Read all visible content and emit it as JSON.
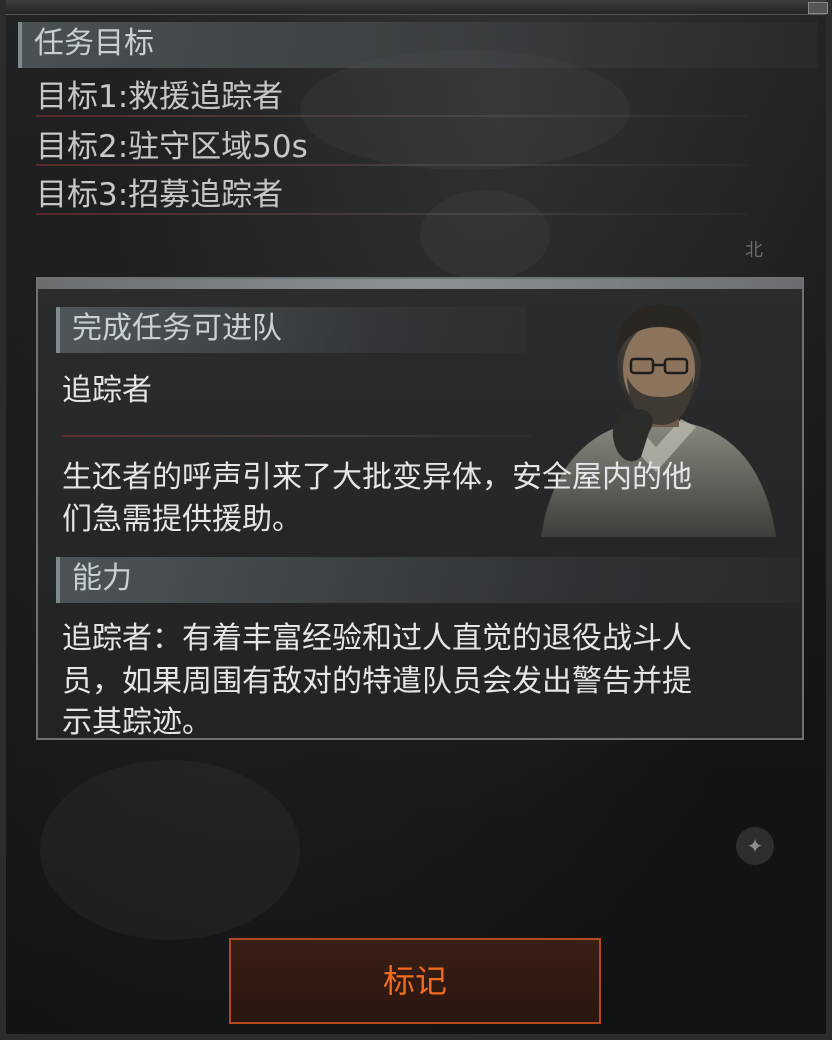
{
  "objectives": {
    "header": "任务目标",
    "items": [
      "目标1:救援追踪者",
      "目标2:驻守区域50s",
      "目标3:招募追踪者"
    ]
  },
  "recruit_panel": {
    "header": "完成任务可进队",
    "character_name": "追踪者",
    "description_line1": "生还者的呼声引来了大批变异体，安全屋内的他",
    "description_line2": "们急需提供援助。",
    "ability_header": "能力",
    "ability_line1": "追踪者：有着丰富经验和过人直觉的退役战斗人",
    "ability_line2": "员，如果周围有敌对的特遣队员会发出警告并提",
    "ability_line3": "示其踪迹。"
  },
  "map": {
    "north_label": "北"
  },
  "actions": {
    "mark_label": "标记"
  },
  "colors": {
    "accent_orange": "#f06a1f",
    "button_border": "#b4481e",
    "text_light": "#e3e6e7",
    "header_text": "#c9d0d3"
  },
  "icons": {
    "compass": "compass-icon",
    "portrait": "tracker-portrait"
  }
}
